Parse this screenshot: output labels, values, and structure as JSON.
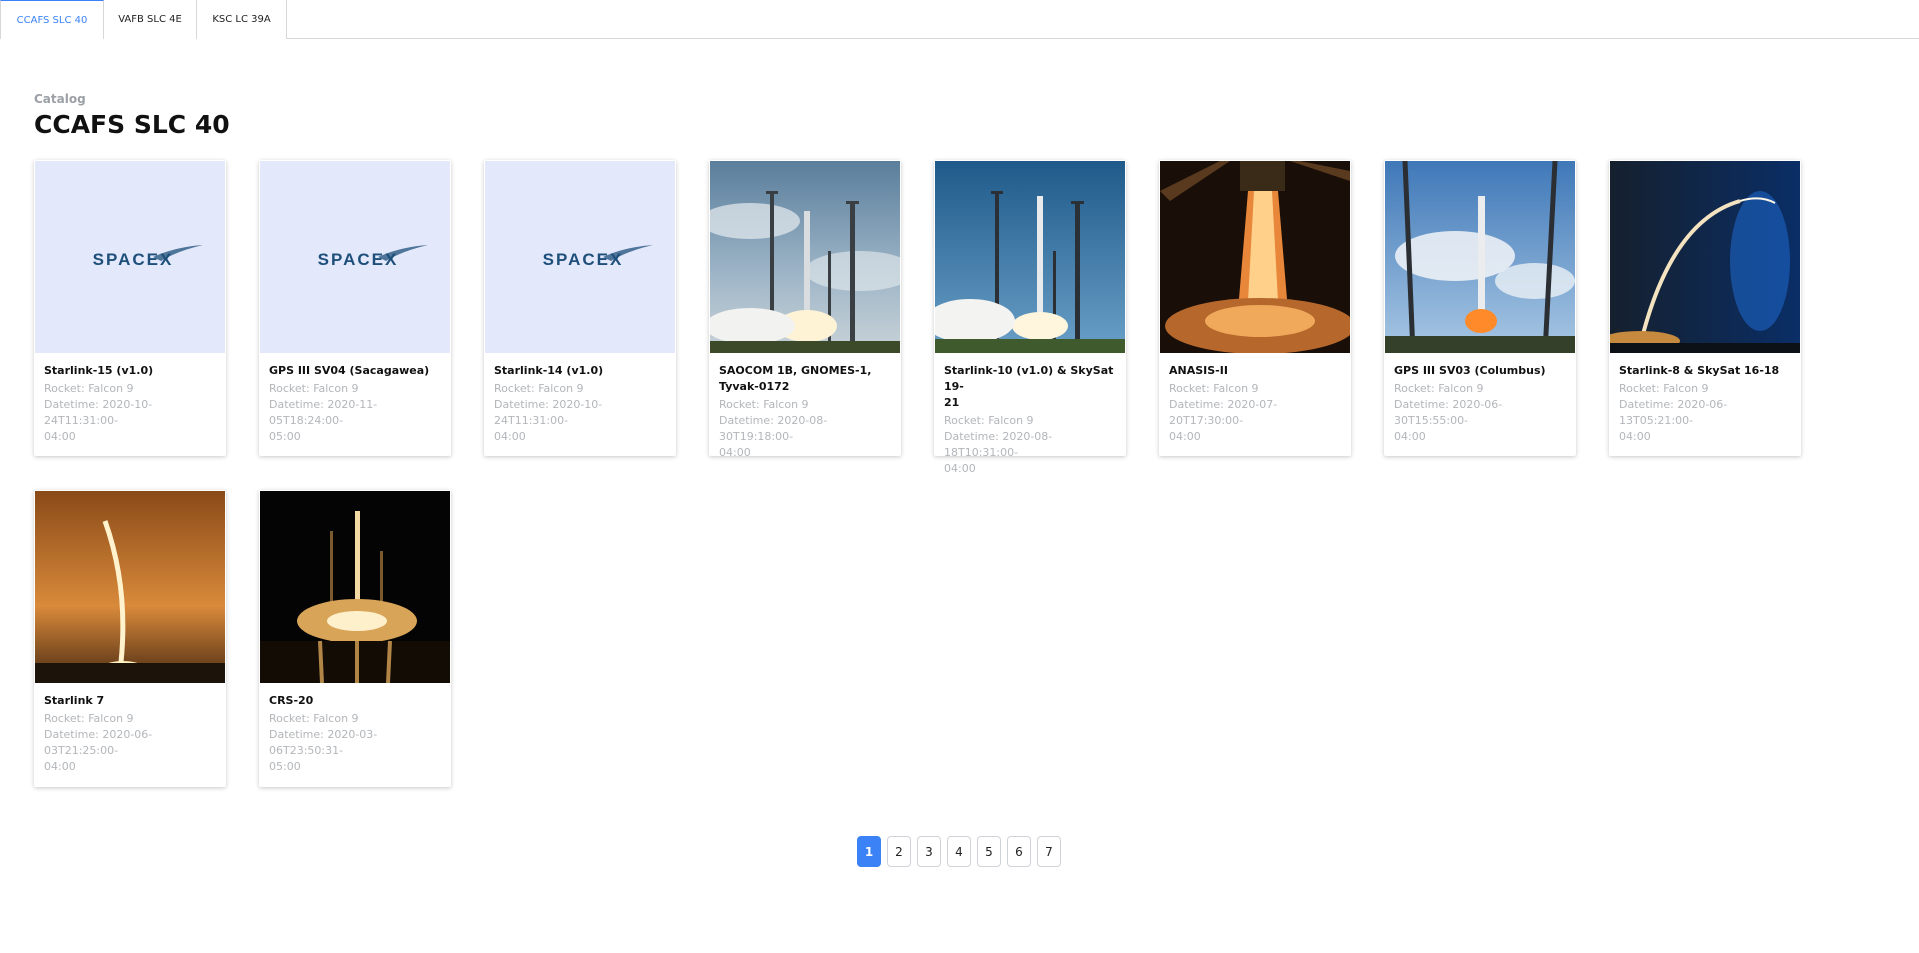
{
  "tabs": [
    {
      "label": "CCAFS SLC 40",
      "active": true
    },
    {
      "label": "VAFB SLC 4E",
      "active": false
    },
    {
      "label": "KSC LC 39A",
      "active": false
    }
  ],
  "header": {
    "eyebrow": "Catalog",
    "title": "CCAFS SLC 40"
  },
  "colors": {
    "accent": "#3b82f6",
    "placeholder_bg": "#e3e8fb",
    "spacex_logo": "#1d4f7a"
  },
  "cards": [
    {
      "name": "Starlink-15 (v1.0)",
      "rocket": "Rocket: Falcon 9",
      "datetime": "Datetime: 2020-10-24T11:31:00-",
      "datetime_tz": "04:00",
      "image": "spacex-logo"
    },
    {
      "name": "GPS III SV04 (Sacagawea)",
      "rocket": "Rocket: Falcon 9",
      "datetime": "Datetime: 2020-11-05T18:24:00-",
      "datetime_tz": "05:00",
      "image": "spacex-logo"
    },
    {
      "name": "Starlink-14 (v1.0)",
      "rocket": "Rocket: Falcon 9",
      "datetime": "Datetime: 2020-10-24T11:31:00-",
      "datetime_tz": "04:00",
      "image": "spacex-logo"
    },
    {
      "name": "SAOCOM 1B, GNOMES-1,",
      "name2": "Tyvak-0172",
      "rocket": "Rocket: Falcon 9",
      "datetime": "Datetime: 2020-08-30T19:18:00-",
      "datetime_tz": "04:00",
      "image": "launch-day-cloudy"
    },
    {
      "name": "Starlink-10 (v1.0) & SkySat 19-",
      "name2": "21",
      "rocket": "Rocket: Falcon 9",
      "datetime": "Datetime: 2020-08-18T10:31:00-",
      "datetime_tz": "04:00",
      "image": "launch-day-blue"
    },
    {
      "name": "ANASIS-II",
      "rocket": "Rocket: Falcon 9",
      "datetime": "Datetime: 2020-07-20T17:30:00-",
      "datetime_tz": "04:00",
      "image": "engine-fire"
    },
    {
      "name": "GPS III SV03 (Columbus)",
      "rocket": "Rocket: Falcon 9",
      "datetime": "Datetime: 2020-06-30T15:55:00-",
      "datetime_tz": "04:00",
      "image": "launch-day-pad"
    },
    {
      "name": "Starlink-8 & SkySat 16-18",
      "rocket": "Rocket: Falcon 9",
      "datetime": "Datetime: 2020-06-13T05:21:00-",
      "datetime_tz": "04:00",
      "image": "night-arc-blue"
    },
    {
      "name": "Starlink 7",
      "rocket": "Rocket: Falcon 9",
      "datetime": "Datetime: 2020-06-03T21:25:00-",
      "datetime_tz": "04:00",
      "image": "dusk-arc-orange"
    },
    {
      "name": "CRS-20",
      "rocket": "Rocket: Falcon 9",
      "datetime": "Datetime: 2020-03-06T23:50:31-",
      "datetime_tz": "05:00",
      "image": "night-pad"
    }
  ],
  "pagination": {
    "pages": [
      "1",
      "2",
      "3",
      "4",
      "5",
      "6",
      "7"
    ],
    "current": "1"
  }
}
